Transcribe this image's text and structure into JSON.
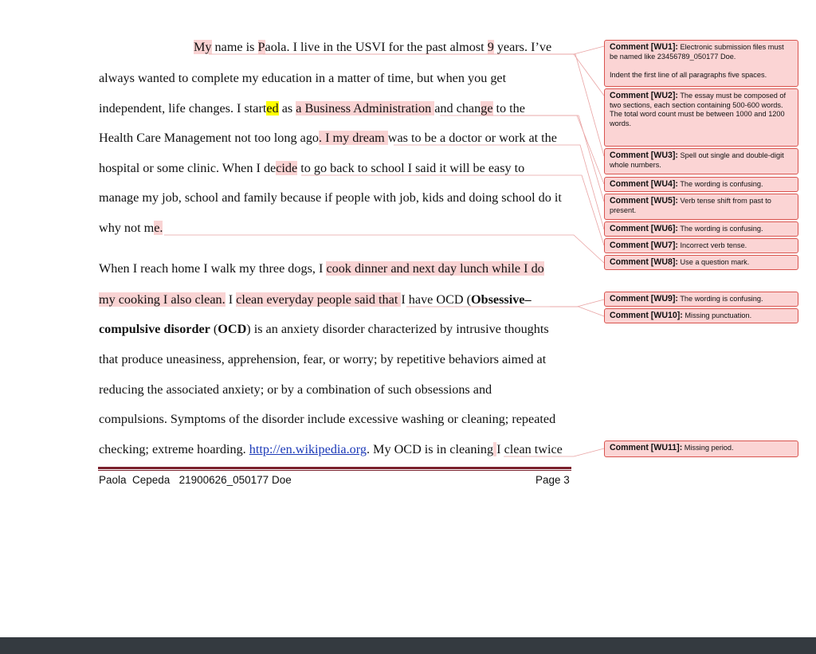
{
  "document": {
    "paragraph1": {
      "line1": {
        "a": "My",
        "b": " name is ",
        "c": "P",
        "d": "aola. I live in the USVI for the past almost ",
        "e": "9",
        "f": " years. I’ve"
      },
      "line2": "always wanted to complete my education in a matter of time, but when you get",
      "line3": {
        "a": "independent, life changes. I start",
        "b": "ed",
        "c": " as ",
        "d": "a Business Administration ",
        "e": "and chan",
        "f": "ge",
        "g": " to the"
      },
      "line4": {
        "a": "Health Care Management not too long ago",
        "b": ". I my dream ",
        "c": "was to be a doctor or work at the"
      },
      "line5": {
        "a": "hospital or some clinic. When I de",
        "b": "cide",
        "c": " to go back to school I said it will be easy to"
      },
      "line6": "manage my job, school and family because if people with job, kids and doing school do it",
      "line7": {
        "a": "why not m",
        "b": "e."
      }
    },
    "paragraph2": {
      "line1": {
        "a": "When I reach home I walk my three dogs, I ",
        "b": "cook dinner and next day lunch while I do"
      },
      "line2": {
        "a": "my cooking I also clean.",
        "b": " I ",
        "c": "clean everyday people said that ",
        "d": "I have OCD (",
        "e": "Obsessive–"
      },
      "line3": {
        "a": "compulsive disorder",
        "b": " (",
        "c": "OCD",
        "d": ") is an anxiety disorder characterized by intrusive thoughts"
      },
      "line4": "that produce uneasiness, apprehension, fear, or worry; by repetitive behaviors aimed at",
      "line5": "reducing the associated anxiety; or by a combination of such obsessions and",
      "line6": "compulsions. Symptoms of the disorder include excessive washing or cleaning; repeated",
      "line7": {
        "a": "checking; extreme hoarding. ",
        "link": "http://en.wikipedia.org",
        "b": ". My OCD is in cleaning",
        "c": " ",
        "d": "I clean twice"
      }
    },
    "footer": {
      "left": "Paola  Cepeda   21900626_050177 Doe",
      "right": "Page 3"
    }
  },
  "comments": [
    {
      "tag": "Comment [WU1]:",
      "text": "Electronic submission files must be named like 23456789_050177 Doe.\n\nIndent the first line of all paragraphs five spaces."
    },
    {
      "tag": "Comment [WU2]:",
      "text": "The essay must be composed of two sections, each section containing 500-600 words.  The total word count must be between 1000 and 1200 words."
    },
    {
      "tag": "Comment [WU3]:",
      "text": "Spell out single and double-digit whole numbers."
    },
    {
      "tag": "Comment [WU4]:",
      "text": "The wording is confusing."
    },
    {
      "tag": "Comment [WU5]:",
      "text": "Verb tense shift from past to present."
    },
    {
      "tag": "Comment [WU6]:",
      "text": "The wording is confusing."
    },
    {
      "tag": "Comment [WU7]:",
      "text": "Incorrect verb tense."
    },
    {
      "tag": "Comment [WU8]:",
      "text": "Use a question mark."
    },
    {
      "tag": "Comment [WU9]:",
      "text": "The wording is confusing."
    },
    {
      "tag": "Comment [WU10]:",
      "text": "Missing punctuation."
    },
    {
      "tag": "Comment [WU11]:",
      "text": "Missing period."
    }
  ],
  "colors": {
    "highlight_comment": "#f9d3d3",
    "highlight_yellow": "#ffff00",
    "comment_border": "#d9544f",
    "comment_fill": "#fbd4d4",
    "footer_rule": "#7a1f2b",
    "link": "#1b39b8",
    "bottom_bar": "#343a40"
  }
}
